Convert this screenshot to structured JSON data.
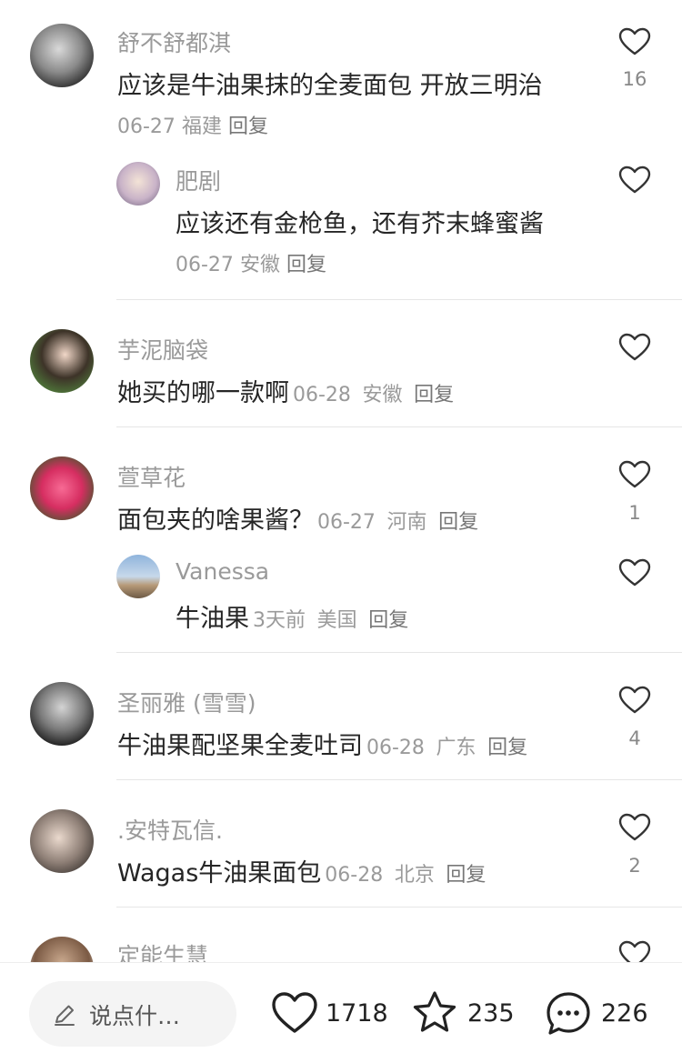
{
  "comments": [
    {
      "user": "舒不舒都淇",
      "text": "应该是牛油果抹的全麦面包 开放三明治",
      "date": "06-27",
      "location": "福建",
      "reply_label": "回复",
      "likes": "16"
    },
    {
      "user": "肥剧",
      "text": "应该还有金枪鱼，还有芥末蜂蜜酱",
      "date": "06-27",
      "location": "安徽",
      "reply_label": "回复",
      "likes": ""
    },
    {
      "user": "芋泥脑袋",
      "text": "她买的哪一款啊",
      "date": "06-28",
      "location": "安徽",
      "reply_label": "回复",
      "likes": ""
    },
    {
      "user": "萱草花",
      "text": "面包夹的啥果酱？",
      "date": "06-27",
      "location": "河南",
      "reply_label": "回复",
      "likes": "1"
    },
    {
      "user": "Vanessa",
      "text": "牛油果",
      "date": "3天前",
      "location": "美国",
      "reply_label": "回复",
      "likes": ""
    },
    {
      "user": "圣丽雅 (雪雪)",
      "text": "牛油果配坚果全麦吐司",
      "date": "06-28",
      "location": "广东",
      "reply_label": "回复",
      "likes": "4"
    },
    {
      "user": ".安特瓦信.",
      "text": "Wagas牛油果面包",
      "date": "06-28",
      "location": "北京",
      "reply_label": "回复",
      "likes": "2"
    },
    {
      "user": "定能生慧",
      "text": "",
      "date": "",
      "location": "",
      "reply_label": "",
      "likes": ""
    }
  ],
  "bottom_bar": {
    "input_placeholder": "说点什…",
    "like_count": "1718",
    "collect_count": "235",
    "comment_count": "226"
  },
  "icons": {
    "like": "heart-outline-icon",
    "collect": "star-outline-icon",
    "comment": "chat-bubble-icon",
    "edit": "pencil-icon"
  },
  "colors": {
    "username": "#9a9a9a",
    "text": "#262626",
    "meta": "#9a9a9a"
  }
}
